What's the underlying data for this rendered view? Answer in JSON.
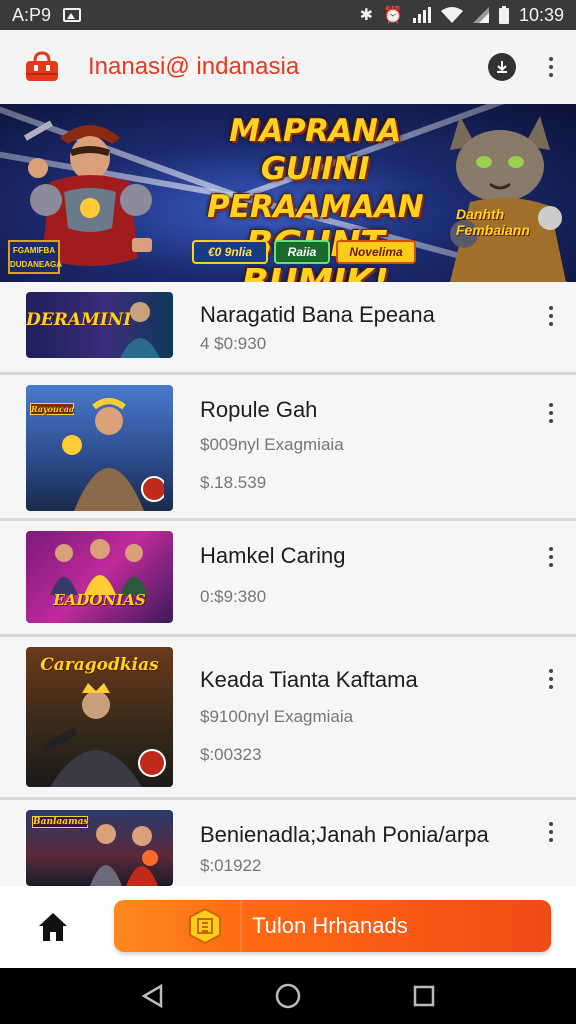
{
  "status_bar": {
    "app_label": "A:P9",
    "time": "10:39",
    "icons": [
      "image-icon",
      "bluetooth-icon",
      "alarm-icon",
      "signal-icon",
      "wifi-icon",
      "cell-signal-icon",
      "battery-icon"
    ]
  },
  "app_bar": {
    "title": "Inanasi@ indanasia",
    "brand_color": "#e53a1a",
    "icons": [
      "shop-logo-icon",
      "download-icon",
      "more-vert-icon"
    ]
  },
  "banner": {
    "title_lines": [
      "MAPRANA GUIINI",
      "PERAAMAAN",
      "BGUNT BUMIK!"
    ],
    "badge_left": "FGAMIFBA DUDANEAGA",
    "pills": [
      "€0 9nlia",
      "Raiia",
      "Novelima"
    ],
    "badge_right": "Danhth Fembaiann"
  },
  "list": {
    "items": [
      {
        "thumb_label": "DERAMINI",
        "title": "Naragatid Bana Epeana",
        "subtitle": "4 $0:930",
        "price": ""
      },
      {
        "thumb_label": "Rayoucaa",
        "title": "Ropule Gah",
        "subtitle": "$009nyl Exagmiaia",
        "price": "$.18.539"
      },
      {
        "thumb_label": "EADONIAS",
        "title": "Hamkel Caring",
        "subtitle": "0:$9:380",
        "price": ""
      },
      {
        "thumb_label": "Caragodkias",
        "title": "Keada Tianta Kaftama",
        "subtitle": "$9100nyl Exagmiaia",
        "price": "$:00323"
      },
      {
        "thumb_label": "Banlaamas",
        "title": "Benienadla;Janah Ponia/arpa",
        "subtitle": "$:01922",
        "price": ""
      }
    ]
  },
  "bottom_bar": {
    "cta_label": "Tulon Hrhanads",
    "cta_color": "#ff6a12",
    "icons": [
      "home-icon",
      "coupon-icon"
    ]
  },
  "nav_bar": {
    "icons": [
      "back-icon",
      "home-circle-icon",
      "recents-icon"
    ]
  }
}
